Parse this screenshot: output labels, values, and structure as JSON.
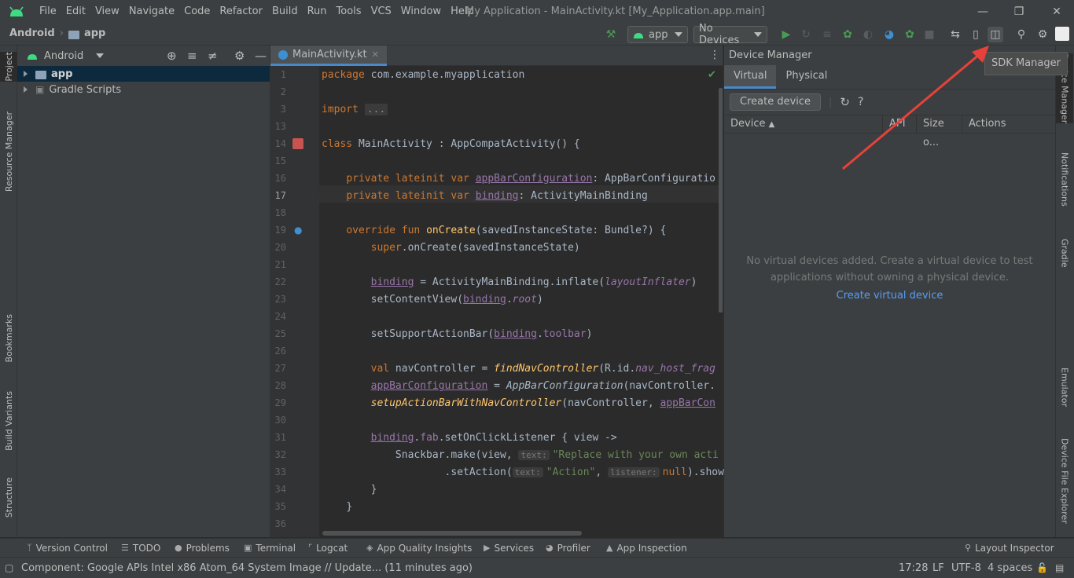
{
  "menu": [
    "File",
    "Edit",
    "View",
    "Navigate",
    "Code",
    "Refactor",
    "Build",
    "Run",
    "Tools",
    "VCS",
    "Window",
    "Help"
  ],
  "window_title": "My Application - MainActivity.kt [My_Application.app.main]",
  "breadcrumb": {
    "project": "Android",
    "module": "app"
  },
  "toolbar": {
    "config": "app",
    "device": "No Devices"
  },
  "left_stripe": [
    "Project",
    "Resource Manager",
    "Bookmarks",
    "Build Variants",
    "Structure"
  ],
  "right_stripe": [
    "Device Manager",
    "Notifications",
    "Gradle",
    "Emulator",
    "Device File Explorer"
  ],
  "project_pane": {
    "view": "Android",
    "items": [
      "app",
      "Gradle Scripts"
    ]
  },
  "editor": {
    "tab": "MainActivity.kt",
    "lines": [
      {
        "n": "1"
      },
      {
        "n": "2"
      },
      {
        "n": "3"
      },
      {
        "n": "13"
      },
      {
        "n": "14"
      },
      {
        "n": "15"
      },
      {
        "n": "16"
      },
      {
        "n": "17"
      },
      {
        "n": "18"
      },
      {
        "n": "19"
      },
      {
        "n": "20"
      },
      {
        "n": "21"
      },
      {
        "n": "22"
      },
      {
        "n": "23"
      },
      {
        "n": "24"
      },
      {
        "n": "25"
      },
      {
        "n": "26"
      },
      {
        "n": "27"
      },
      {
        "n": "28"
      },
      {
        "n": "29"
      },
      {
        "n": "30"
      },
      {
        "n": "31"
      },
      {
        "n": "32"
      },
      {
        "n": "33"
      },
      {
        "n": "34"
      },
      {
        "n": "35"
      },
      {
        "n": "36"
      }
    ],
    "code": {
      "l1a": "package",
      "l1b": " com.example.myapplication",
      "l3a": "import",
      "l3b": "...",
      "l14a": "class",
      "l14b": " MainActivity : AppCompatActivity() {",
      "l16a": "private lateinit var",
      "l16b": "appBarConfiguration",
      "l16c": ": AppBarConfiguratio",
      "l17a": "private lateinit var",
      "l17b": "binding",
      "l17c": ": ActivityMainBinding",
      "l19a": "override fun",
      "l19b": "onCreate",
      "l19c": "(savedInstanceState: Bundle?) {",
      "l20a": "super",
      "l20b": ".onCreate(savedInstanceState)",
      "l22a": "binding",
      "l22b": " = ActivityMainBinding.inflate(",
      "l22c": "layoutInflater",
      "l22d": ")",
      "l23a": "setContentView(",
      "l23b": "binding",
      "l23c": ".",
      "l23d": "root",
      "l23e": ")",
      "l25a": "setSupportActionBar(",
      "l25b": "binding",
      "l25c": ".",
      "l25d": "toolbar",
      "l25e": ")",
      "l27a": "val",
      "l27b": " navController = ",
      "l27c": "findNavController",
      "l27d": "(R.id.",
      "l27e": "nav_host_frag",
      "l28a": "appBarConfiguration",
      "l28b": " = ",
      "l28c": "AppBarConfiguration",
      "l28d": "(navController.",
      "l29a": "setupActionBarWithNavController",
      "l29b": "(navController, ",
      "l29c": "appBarCon",
      "l31a": "binding",
      "l31b": ".",
      "l31c": "fab",
      "l31d": ".setOnClickListener { view ->",
      "l32a": "Snackbar.make(view, ",
      "l32h": "text:",
      "l32b": "\"Replace with your own acti",
      "l33a": ".setAction(",
      "l33h1": "text:",
      "l33b": "\"Action\"",
      "l33c": ", ",
      "l33h2": "listener:",
      "l33d": "null",
      "l33e": ").show(",
      "l34": "}",
      "l35": "}"
    }
  },
  "device_manager": {
    "title": "Device Manager",
    "tabs": [
      "Virtual",
      "Physical"
    ],
    "create_button": "Create device",
    "columns": [
      "Device",
      "API",
      "Size o...",
      "Actions"
    ],
    "empty_text_1": "No virtual devices added. Create a virtual device to test",
    "empty_text_2": "applications without owning a physical device.",
    "create_link": "Create virtual device"
  },
  "tooltip": "SDK Manager",
  "bottom_tools": [
    "Version Control",
    "TODO",
    "Problems",
    "Terminal",
    "Logcat",
    "App Quality Insights",
    "Services",
    "Profiler",
    "App Inspection",
    "Layout Inspector"
  ],
  "status": {
    "message": "Component: Google APIs Intel x86 Atom_64 System Image // Update... (11 minutes ago)",
    "position": "17:28",
    "line_sep": "LF",
    "encoding": "UTF-8",
    "indent": "4 spaces"
  },
  "colors": {
    "accent": "#4a88c7",
    "annotation_arrow": "#e8413a",
    "run": "#499c54"
  }
}
